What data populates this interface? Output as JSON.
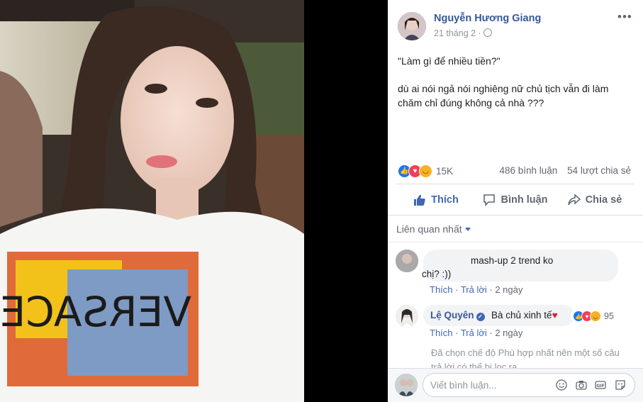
{
  "post": {
    "author": "Nguyễn Hương Giang",
    "date": "21 tháng 2 ·",
    "more": "•••",
    "text_line1": "\"Làm gì để nhiều tiền?\"",
    "text_line2": "dù ai nói ngả nói nghiêng nữ chủ tịch vẫn đi làm chăm chỉ đúng không cả nhà ???",
    "photo_shirt_text": "VERSACE"
  },
  "stats": {
    "reactions": "15K",
    "comments": "486 bình luận",
    "shares": "54 lượt chia sẻ",
    "reaction_icons": [
      "like-icon",
      "love-icon",
      "haha-icon"
    ]
  },
  "actions": {
    "like": "Thích",
    "comment": "Bình luận",
    "share": "Chia sẻ"
  },
  "filter": {
    "label": "Liên quan nhất"
  },
  "comments": [
    {
      "text_part1": "mash-up 2 trend ko",
      "text_part2": "chị? :))",
      "like": "Thích",
      "reply": "Trả lời",
      "time": "2 ngày"
    },
    {
      "name": "Lệ Quyên",
      "text": "Bà chủ xinh tế",
      "heart": "♥",
      "reaction_count": "95",
      "like": "Thích",
      "reply": "Trả lời",
      "time": "2 ngày"
    }
  ],
  "notice": "Đã chọn chế độ Phù hợp nhất nên một số câu trả lời có thể bị lọc ra.",
  "composer": {
    "placeholder": "Viết bình luận...",
    "icons": [
      "emoji-icon",
      "camera-icon",
      "gif-icon",
      "sticker-icon"
    ]
  },
  "colors": {
    "link_blue": "#365899",
    "action_blue": "#4267b2",
    "like_blue": "#1877f2",
    "love_red": "#f33e58",
    "haha_yellow": "#f7b125"
  }
}
